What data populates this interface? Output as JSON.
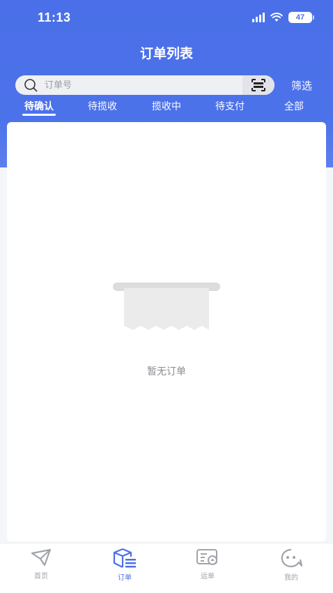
{
  "status_bar": {
    "time": "11:13",
    "battery": "47"
  },
  "header": {
    "title": "订单列表"
  },
  "search": {
    "placeholder": "订单号",
    "filter_label": "筛选"
  },
  "tabs": [
    {
      "label": "待确认",
      "active": true
    },
    {
      "label": "待揽收",
      "active": false
    },
    {
      "label": "揽收中",
      "active": false
    },
    {
      "label": "待支付",
      "active": false
    },
    {
      "label": "全部",
      "active": false
    }
  ],
  "empty": {
    "text": "暂无订单"
  },
  "tabbar": [
    {
      "label": "首页",
      "icon": "paper-plane-icon",
      "active": false
    },
    {
      "label": "订单",
      "icon": "package-list-icon",
      "active": true
    },
    {
      "label": "运单",
      "icon": "waybill-icon",
      "active": false
    },
    {
      "label": "我的",
      "icon": "face-icon",
      "active": false
    }
  ],
  "colors": {
    "primary": "#4a6fe8",
    "background": "#f5f6fa",
    "inactive": "#a0a3aa"
  }
}
